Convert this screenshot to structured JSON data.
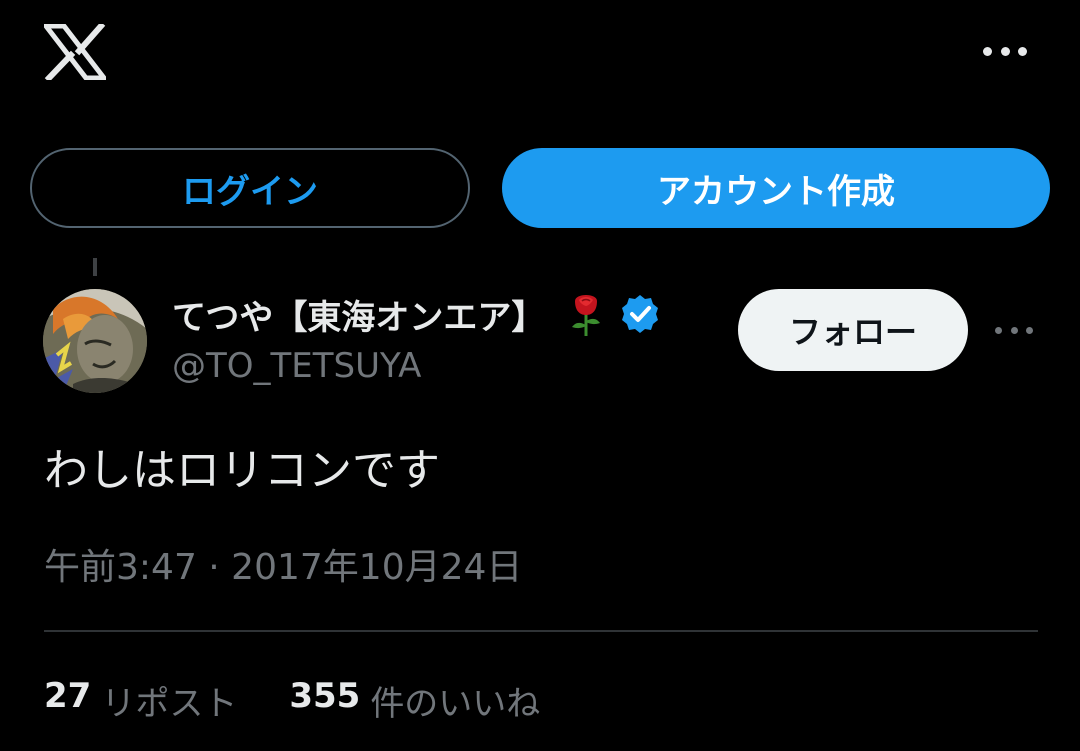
{
  "header": {
    "logo_icon": "x-logo-icon",
    "more_icon": "more-horizontal-icon"
  },
  "auth": {
    "login_label": "ログイン",
    "signup_label": "アカウント作成"
  },
  "post": {
    "author": {
      "display_name": "てつや【東海オンエア】",
      "emoji_icon": "rose-icon",
      "verified_icon": "verified-badge-icon",
      "handle": "@TO_TETSUYA"
    },
    "follow_label": "フォロー",
    "more_icon": "more-horizontal-icon",
    "text": "わしはロリコンです",
    "timestamp": "午前3:47 · 2017年10月24日",
    "stats": {
      "reposts_count": "27",
      "reposts_label": "リポスト",
      "likes_count": "355",
      "likes_label": "件のいいね"
    }
  },
  "colors": {
    "background": "#000000",
    "accent": "#1d9bf0",
    "text_primary": "#e7e9ea",
    "text_secondary": "#71767b",
    "follow_button_bg": "#eff3f4",
    "divider": "#2f3336"
  }
}
